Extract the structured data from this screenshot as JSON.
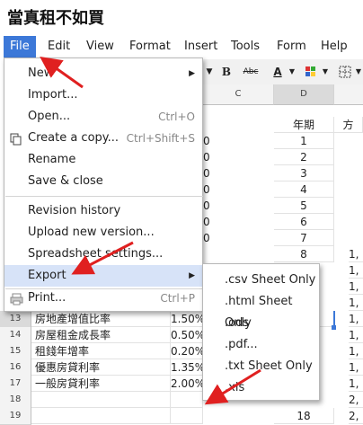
{
  "document": {
    "title": "當真租不如買"
  },
  "menubar": {
    "items": [
      "File",
      "Edit",
      "View",
      "Format",
      "Insert",
      "Tools",
      "Form",
      "Help"
    ]
  },
  "toolbar": {
    "bold": "B",
    "strike": "Abc",
    "text_color": "A"
  },
  "columns": [
    "C",
    "D"
  ],
  "col_d_header": "年期",
  "col_e_header": "方",
  "rows": [
    {
      "num": "13",
      "label": "房地產增值比率",
      "value": "1.50%",
      "d": "",
      "e": "1,"
    },
    {
      "num": "14",
      "label": "房屋租金成長率",
      "value": "0.50%",
      "d": "",
      "e": "1,"
    },
    {
      "num": "15",
      "label": "租錢年增率",
      "value": "0.20%",
      "d": "",
      "e": "1,"
    },
    {
      "num": "16",
      "label": "優惠房貸利率",
      "value": "1.35%",
      "d": "",
      "e": "1,"
    },
    {
      "num": "17",
      "label": "一般房貸利率",
      "value": "2.00%",
      "d": "",
      "e": "1,"
    },
    {
      "num": "18",
      "label": "",
      "value": "",
      "d": "",
      "e": "2,"
    },
    {
      "num": "19",
      "label": "",
      "value": "",
      "d": "18",
      "e": "2,"
    }
  ],
  "d_values": [
    "1",
    "2",
    "3",
    "4",
    "5",
    "6",
    "7",
    "8"
  ],
  "e_values": [
    "1,",
    "1,",
    "1,",
    "1,",
    "1,",
    "1,",
    "1,",
    "1,"
  ],
  "b_partial": [
    "0",
    "0",
    "0",
    "0",
    "0",
    "0",
    "0"
  ],
  "file_menu": {
    "new": "New",
    "import": "Import...",
    "open": "Open...",
    "open_shortcut": "Ctrl+O",
    "copy": "Create a copy...",
    "copy_shortcut": "Ctrl+Shift+S",
    "rename": "Rename",
    "save_close": "Save & close",
    "revision": "Revision history",
    "upload": "Upload new version...",
    "settings": "Spreadsheet settings...",
    "export": "Export",
    "print": "Print...",
    "print_shortcut": "Ctrl+P"
  },
  "export_menu": [
    ".csv Sheet Only",
    ".html Sheet Only",
    ".ods",
    ".pdf...",
    ".txt Sheet Only",
    ".xls"
  ],
  "colors": {
    "menu_active": "#3c78d8",
    "highlight": "#d7e3f8",
    "arrow": "#e02020"
  }
}
